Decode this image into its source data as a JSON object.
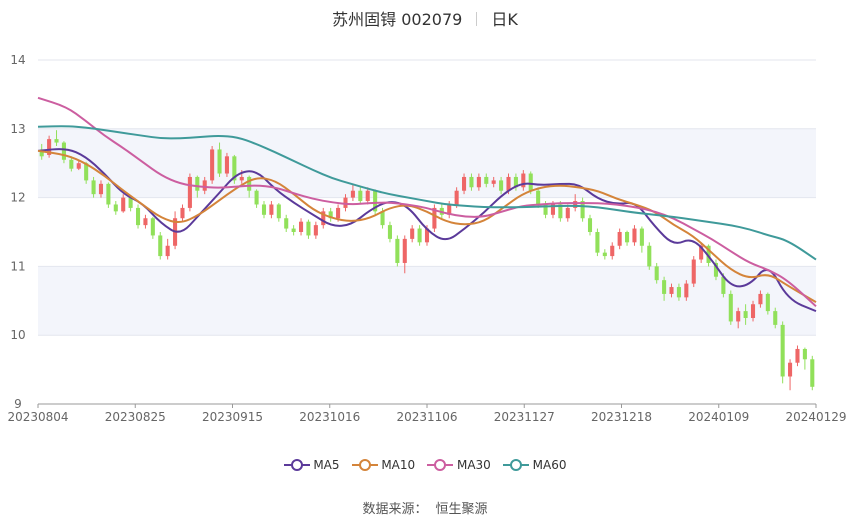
{
  "header": {
    "stock_name": "苏州固锝 002079",
    "period": "日K"
  },
  "source": {
    "label": "数据来源：",
    "provider": "恒生聚源"
  },
  "chart_data": {
    "type": "candlestick",
    "title": "苏州固锝 002079 日K",
    "ylim": [
      9,
      14
    ],
    "y_ticks": [
      "9",
      "10",
      "11",
      "12",
      "13",
      "14"
    ],
    "x_ticks": [
      "20230804",
      "20230825",
      "20230915",
      "20231016",
      "20231106",
      "20231127",
      "20231218",
      "20240109",
      "20240129"
    ],
    "grid": true,
    "legend_position": "bottom-center",
    "colors": {
      "up": "#ee6666",
      "down": "#91e05a"
    },
    "series": [
      {
        "name": "MA5",
        "color": "#5b3a9a",
        "x": [
          0,
          6,
          10,
          14,
          18,
          22,
          26,
          30,
          34,
          38,
          42,
          46,
          50,
          54,
          58,
          62,
          66,
          70,
          74,
          78,
          82,
          86,
          90,
          94,
          98,
          102,
          106,
          110,
          114,
          118,
          122,
          126,
          130,
          134,
          138,
          142,
          146,
          150,
          154,
          158,
          164
        ],
        "values": [
          12.68,
          12.72,
          12.6,
          12.35,
          12.05,
          11.92,
          11.62,
          11.45,
          11.75,
          12.05,
          12.36,
          12.4,
          12.12,
          11.92,
          11.75,
          11.58,
          11.6,
          11.82,
          11.96,
          11.88,
          11.52,
          11.35,
          11.55,
          11.78,
          12.05,
          12.22,
          12.18,
          12.2,
          12.2,
          11.98,
          11.9,
          11.94,
          11.58,
          11.3,
          11.42,
          11.1,
          10.7,
          10.72,
          11.05,
          10.52,
          10.35
        ]
      },
      {
        "name": "MA10",
        "color": "#d4843a",
        "x": [
          0,
          6,
          10,
          14,
          18,
          22,
          26,
          30,
          34,
          38,
          42,
          46,
          50,
          54,
          58,
          62,
          66,
          70,
          74,
          78,
          82,
          86,
          90,
          94,
          98,
          102,
          106,
          110,
          114,
          118,
          122,
          126,
          130,
          134,
          138,
          142,
          146,
          150,
          154,
          158,
          164
        ],
        "values": [
          12.68,
          12.62,
          12.5,
          12.32,
          12.1,
          11.9,
          11.7,
          11.62,
          11.75,
          11.95,
          12.15,
          12.3,
          12.25,
          12.05,
          11.82,
          11.7,
          11.65,
          11.7,
          11.85,
          11.9,
          11.8,
          11.65,
          11.6,
          11.65,
          11.85,
          12.05,
          12.15,
          12.18,
          12.15,
          12.1,
          11.98,
          11.9,
          11.8,
          11.6,
          11.45,
          11.2,
          10.95,
          10.82,
          10.9,
          10.72,
          10.48
        ]
      },
      {
        "name": "MA30",
        "color": "#cc5ea0",
        "x": [
          0,
          6,
          10,
          14,
          18,
          22,
          26,
          30,
          34,
          38,
          42,
          46,
          50,
          54,
          58,
          62,
          66,
          70,
          74,
          78,
          82,
          86,
          90,
          94,
          98,
          102,
          106,
          110,
          114,
          118,
          122,
          126,
          130,
          134,
          138,
          142,
          146,
          150,
          154,
          158,
          164
        ],
        "values": [
          13.45,
          13.32,
          13.12,
          12.9,
          12.72,
          12.52,
          12.32,
          12.2,
          12.16,
          12.14,
          12.16,
          12.18,
          12.15,
          12.06,
          11.98,
          11.93,
          11.9,
          11.92,
          11.93,
          11.9,
          11.85,
          11.77,
          11.72,
          11.72,
          11.8,
          11.88,
          11.9,
          11.92,
          11.92,
          11.92,
          11.9,
          11.86,
          11.8,
          11.7,
          11.55,
          11.4,
          11.22,
          11.05,
          10.95,
          10.8,
          10.42
        ]
      },
      {
        "name": "MA60",
        "color": "#3f9a9a",
        "x": [
          0,
          6,
          10,
          14,
          18,
          22,
          26,
          30,
          34,
          38,
          42,
          46,
          50,
          54,
          58,
          62,
          66,
          70,
          74,
          78,
          82,
          86,
          90,
          94,
          98,
          102,
          106,
          110,
          114,
          118,
          122,
          126,
          130,
          134,
          138,
          142,
          146,
          150,
          154,
          158,
          164
        ],
        "values": [
          13.03,
          13.04,
          13.02,
          12.98,
          12.94,
          12.9,
          12.86,
          12.86,
          12.88,
          12.9,
          12.88,
          12.78,
          12.66,
          12.53,
          12.4,
          12.28,
          12.2,
          12.12,
          12.05,
          12.0,
          11.95,
          11.9,
          11.88,
          11.86,
          11.86,
          11.86,
          11.87,
          11.88,
          11.88,
          11.86,
          11.82,
          11.78,
          11.75,
          11.72,
          11.68,
          11.64,
          11.6,
          11.54,
          11.45,
          11.38,
          11.1
        ]
      }
    ],
    "candles": [
      [
        12.7,
        12.6,
        12.78,
        12.55
      ],
      [
        12.62,
        12.85,
        12.9,
        12.58
      ],
      [
        12.85,
        12.8,
        12.98,
        12.75
      ],
      [
        12.8,
        12.55,
        12.82,
        12.5
      ],
      [
        12.55,
        12.42,
        12.6,
        12.38
      ],
      [
        12.42,
        12.5,
        12.55,
        12.4
      ],
      [
        12.5,
        12.25,
        12.52,
        12.2
      ],
      [
        12.25,
        12.05,
        12.3,
        12.0
      ],
      [
        12.05,
        12.2,
        12.25,
        12.0
      ],
      [
        12.2,
        11.9,
        12.22,
        11.85
      ],
      [
        11.9,
        11.8,
        11.95,
        11.75
      ],
      [
        11.8,
        12.0,
        12.05,
        11.78
      ],
      [
        12.0,
        11.85,
        12.02,
        11.8
      ],
      [
        11.85,
        11.6,
        11.9,
        11.55
      ],
      [
        11.6,
        11.7,
        11.75,
        11.55
      ],
      [
        11.7,
        11.45,
        11.72,
        11.4
      ],
      [
        11.45,
        11.15,
        11.5,
        11.1
      ],
      [
        11.15,
        11.3,
        11.4,
        11.1
      ],
      [
        11.3,
        11.7,
        11.8,
        11.25
      ],
      [
        11.7,
        11.85,
        11.9,
        11.65
      ],
      [
        11.85,
        12.3,
        12.35,
        11.8
      ],
      [
        12.3,
        12.1,
        12.32,
        12.0
      ],
      [
        12.1,
        12.25,
        12.3,
        12.05
      ],
      [
        12.25,
        12.7,
        12.75,
        12.2
      ],
      [
        12.7,
        12.35,
        12.8,
        12.3
      ],
      [
        12.35,
        12.6,
        12.65,
        12.3
      ],
      [
        12.6,
        12.25,
        12.62,
        12.2
      ],
      [
        12.25,
        12.3,
        12.4,
        12.2
      ],
      [
        12.3,
        12.1,
        12.32,
        12.0
      ],
      [
        12.1,
        11.9,
        12.12,
        11.85
      ],
      [
        11.9,
        11.75,
        11.95,
        11.7
      ],
      [
        11.75,
        11.9,
        11.95,
        11.7
      ],
      [
        11.9,
        11.7,
        11.92,
        11.65
      ],
      [
        11.7,
        11.55,
        11.75,
        11.5
      ],
      [
        11.55,
        11.5,
        11.6,
        11.45
      ],
      [
        11.5,
        11.65,
        11.7,
        11.45
      ],
      [
        11.65,
        11.45,
        11.68,
        11.4
      ],
      [
        11.45,
        11.6,
        11.65,
        11.4
      ],
      [
        11.6,
        11.8,
        11.85,
        11.55
      ],
      [
        11.8,
        11.7,
        11.85,
        11.65
      ],
      [
        11.7,
        11.85,
        11.9,
        11.65
      ],
      [
        11.85,
        12.0,
        12.05,
        11.8
      ],
      [
        12.0,
        12.1,
        12.2,
        11.95
      ],
      [
        12.1,
        11.95,
        12.15,
        11.9
      ],
      [
        11.95,
        12.1,
        12.15,
        11.9
      ],
      [
        12.1,
        11.8,
        12.12,
        11.75
      ],
      [
        11.8,
        11.6,
        11.85,
        11.55
      ],
      [
        11.6,
        11.4,
        11.65,
        11.35
      ],
      [
        11.4,
        11.05,
        11.45,
        11.0
      ],
      [
        11.05,
        11.4,
        11.45,
        10.9
      ],
      [
        11.4,
        11.55,
        11.6,
        11.35
      ],
      [
        11.55,
        11.35,
        11.6,
        11.3
      ],
      [
        11.35,
        11.55,
        11.6,
        11.3
      ],
      [
        11.55,
        11.85,
        11.9,
        11.5
      ],
      [
        11.85,
        11.75,
        11.9,
        11.7
      ],
      [
        11.75,
        11.9,
        11.95,
        11.7
      ],
      [
        11.9,
        12.1,
        12.15,
        11.85
      ],
      [
        12.1,
        12.3,
        12.35,
        12.05
      ],
      [
        12.3,
        12.15,
        12.35,
        12.1
      ],
      [
        12.15,
        12.3,
        12.35,
        12.1
      ],
      [
        12.3,
        12.2,
        12.35,
        12.15
      ],
      [
        12.2,
        12.25,
        12.3,
        12.15
      ],
      [
        12.25,
        12.1,
        12.3,
        12.05
      ],
      [
        12.1,
        12.3,
        12.35,
        12.05
      ],
      [
        12.3,
        12.15,
        12.35,
        12.1
      ],
      [
        12.15,
        12.35,
        12.4,
        12.1
      ],
      [
        12.35,
        12.1,
        12.38,
        12.05
      ],
      [
        12.1,
        11.9,
        12.15,
        11.85
      ],
      [
        11.9,
        11.75,
        11.95,
        11.7
      ],
      [
        11.75,
        11.9,
        11.95,
        11.7
      ],
      [
        11.9,
        11.7,
        11.95,
        11.65
      ],
      [
        11.7,
        11.85,
        11.9,
        11.65
      ],
      [
        11.85,
        11.95,
        12.05,
        11.8
      ],
      [
        11.95,
        11.7,
        12.0,
        11.65
      ],
      [
        11.7,
        11.5,
        11.75,
        11.45
      ],
      [
        11.5,
        11.2,
        11.55,
        11.15
      ],
      [
        11.2,
        11.15,
        11.25,
        11.1
      ],
      [
        11.15,
        11.3,
        11.35,
        11.1
      ],
      [
        11.3,
        11.5,
        11.55,
        11.25
      ],
      [
        11.5,
        11.35,
        11.52,
        11.3
      ],
      [
        11.35,
        11.55,
        11.6,
        11.3
      ],
      [
        11.55,
        11.3,
        11.58,
        11.2
      ],
      [
        11.3,
        11.0,
        11.35,
        10.95
      ],
      [
        11.0,
        10.8,
        11.05,
        10.75
      ],
      [
        10.8,
        10.6,
        10.85,
        10.5
      ],
      [
        10.6,
        10.7,
        10.75,
        10.55
      ],
      [
        10.7,
        10.55,
        10.75,
        10.5
      ],
      [
        10.55,
        10.75,
        10.8,
        10.5
      ],
      [
        10.75,
        11.1,
        11.15,
        10.7
      ],
      [
        11.1,
        11.3,
        11.35,
        11.05
      ],
      [
        11.3,
        11.05,
        11.32,
        11.0
      ],
      [
        11.05,
        10.85,
        11.1,
        10.8
      ],
      [
        10.85,
        10.6,
        10.9,
        10.55
      ],
      [
        10.6,
        10.2,
        10.65,
        10.15
      ],
      [
        10.2,
        10.35,
        10.4,
        10.1
      ],
      [
        10.35,
        10.25,
        10.45,
        10.15
      ],
      [
        10.25,
        10.45,
        10.5,
        10.2
      ],
      [
        10.45,
        10.6,
        10.65,
        10.4
      ],
      [
        10.6,
        10.35,
        10.62,
        10.3
      ],
      [
        10.35,
        10.15,
        10.4,
        10.1
      ],
      [
        10.15,
        9.4,
        10.2,
        9.3
      ],
      [
        9.4,
        9.6,
        9.65,
        9.2
      ],
      [
        9.6,
        9.8,
        9.85,
        9.55
      ],
      [
        9.8,
        9.65,
        9.82,
        9.5
      ],
      [
        9.65,
        9.25,
        9.7,
        9.2
      ]
    ]
  }
}
